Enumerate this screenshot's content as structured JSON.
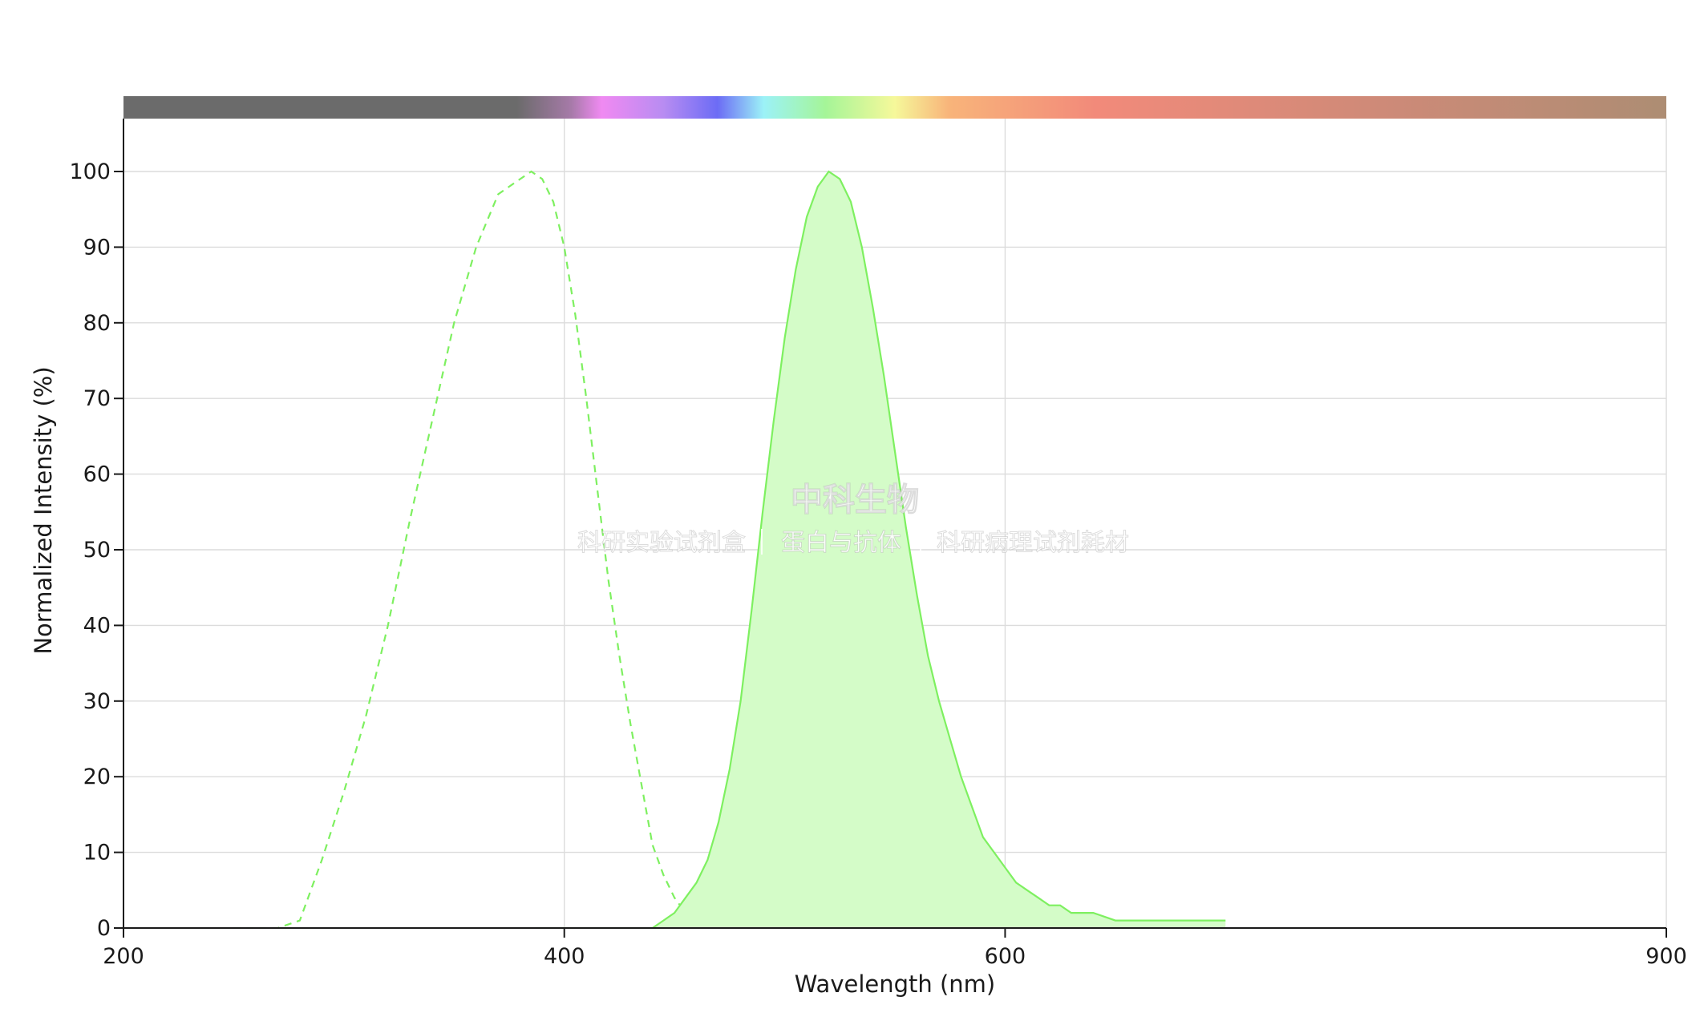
{
  "chart_data": {
    "type": "area",
    "title": "",
    "xlabel": "Wavelength (nm)",
    "ylabel": "Normalized Intensity (%)",
    "xlim": [
      200,
      900
    ],
    "ylim": [
      0,
      100
    ],
    "x_ticks": [
      200,
      400,
      600,
      900
    ],
    "y_ticks": [
      0,
      10,
      20,
      30,
      40,
      50,
      60,
      70,
      80,
      90,
      100
    ],
    "grid": true,
    "legend": "none",
    "spectrum_bar": true,
    "colors": {
      "series": "#7ef060",
      "fill": "#d4fcc8",
      "grid": "#dcdcdc",
      "axis": "#1a1a1a"
    },
    "series": [
      {
        "style": "dashed",
        "x": [
          250,
          270,
          280,
          290,
          300,
          310,
          320,
          330,
          340,
          350,
          360,
          370,
          380,
          385,
          390,
          395,
          400,
          405,
          410,
          415,
          420,
          425,
          430,
          435,
          440,
          445,
          450,
          455,
          460,
          465,
          470,
          475,
          480,
          490,
          500,
          525
        ],
        "y": [
          0,
          0,
          1,
          9,
          18,
          28,
          40,
          54,
          67,
          80,
          90,
          97,
          99,
          100,
          99,
          96,
          90,
          81,
          70,
          58,
          46,
          36,
          27,
          19,
          11,
          7,
          4,
          2,
          1,
          0.5,
          0,
          0,
          0,
          0,
          0,
          0
        ]
      },
      {
        "style": "solid-filled",
        "x": [
          387,
          440,
          445,
          450,
          455,
          460,
          465,
          470,
          475,
          480,
          485,
          490,
          495,
          500,
          505,
          510,
          515,
          520,
          525,
          530,
          535,
          540,
          545,
          550,
          555,
          560,
          565,
          570,
          575,
          580,
          585,
          590,
          595,
          600,
          605,
          610,
          615,
          620,
          625,
          630,
          635,
          640,
          645,
          650,
          655,
          660,
          665,
          670,
          675,
          680,
          690,
          700
        ],
        "y": [
          0,
          0,
          1,
          2,
          4,
          6,
          9,
          14,
          21,
          30,
          42,
          55,
          67,
          78,
          87,
          94,
          98,
          100,
          99,
          96,
          90,
          82,
          73,
          63,
          53,
          44,
          36,
          30,
          25,
          20,
          16,
          12,
          10,
          8,
          6,
          5,
          4,
          3,
          3,
          2,
          2,
          2,
          1.5,
          1,
          1,
          1,
          1,
          1,
          1,
          1,
          1,
          1
        ]
      }
    ]
  },
  "watermark": {
    "title": "中科生物",
    "subtitle_parts": [
      "科研实验试剂盒",
      "蛋白与抗体",
      "科研病理试剂耗材"
    ]
  }
}
